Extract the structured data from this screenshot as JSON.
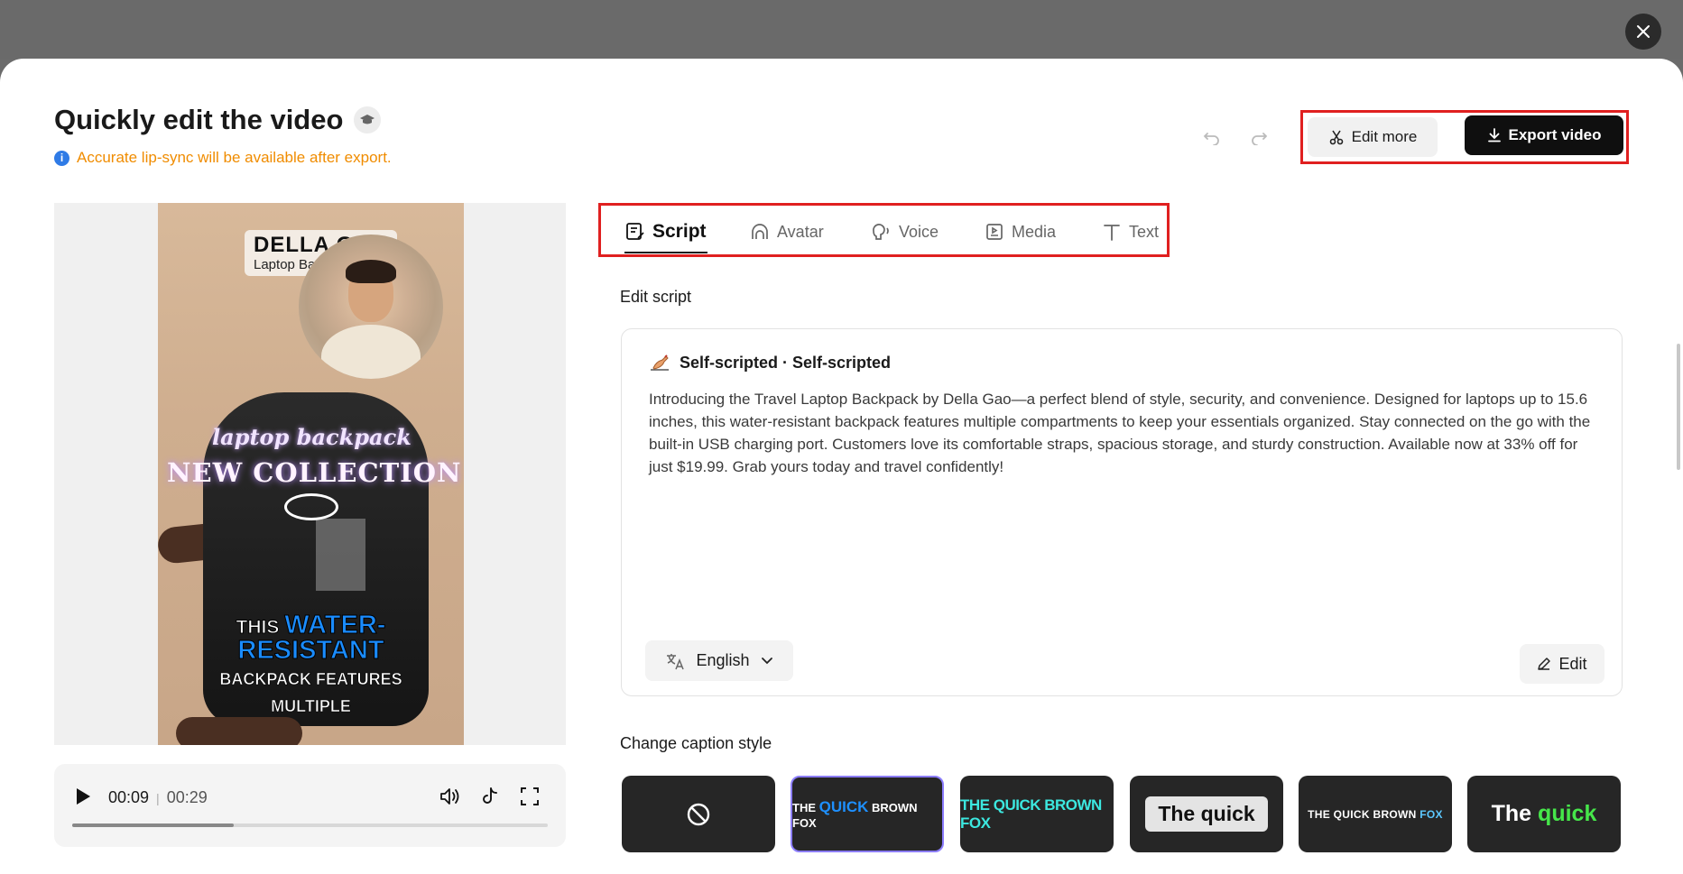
{
  "header": {
    "title": "Quickly edit the video",
    "notice": "Accurate lip-sync will be available after export.",
    "edit_more_label": "Edit more",
    "export_label": "Export video"
  },
  "video": {
    "brand_name": "DELLA GAO",
    "brand_sub": "Laptop Backpack",
    "overlay_script": "laptop backpack",
    "overlay_title": "NEW COLLECTION",
    "caption_line1_a": "THIS",
    "caption_line1_b": "WATER-",
    "caption_line2": "RESISTANT",
    "caption_line3": "BACKPACK FEATURES",
    "caption_line4": "MULTIPLE"
  },
  "player": {
    "current_time": "00:09",
    "duration": "00:29",
    "progress": 0.34
  },
  "tabs": [
    {
      "label": "Script",
      "active": true
    },
    {
      "label": "Avatar",
      "active": false
    },
    {
      "label": "Voice",
      "active": false
    },
    {
      "label": "Media",
      "active": false
    },
    {
      "label": "Text",
      "active": false
    }
  ],
  "script": {
    "section_label": "Edit script",
    "source": "Self-scripted · Self-scripted",
    "body": "Introducing the Travel Laptop Backpack by Della Gao—a perfect blend of style, security, and convenience. Designed for laptops up to 15.6 inches, this water-resistant backpack features multiple compartments to keep your essentials organized. Stay connected on the go with the built-in USB charging port. Customers love its comfortable straps, spacious storage, and sturdy construction. Available now at 33% off for just $19.99. Grab yours today and travel confidently!",
    "language": "English",
    "edit_label": "Edit"
  },
  "caption_styles": {
    "section_label": "Change caption style",
    "styles": [
      {
        "id": "none"
      },
      {
        "parts": [
          "THE ",
          "QUICK",
          " BROWN FOX"
        ],
        "selected": true
      },
      {
        "text": "THE QUICK BROWN FOX"
      },
      {
        "text": "The quick"
      },
      {
        "parts": [
          "THE QUICK BROWN ",
          "FOX"
        ]
      },
      {
        "parts": [
          "The ",
          "quick"
        ]
      }
    ]
  },
  "colors": {
    "accent_red_outline": "#e02020",
    "notice_orange": "#f08c00",
    "selected_style_border": "#8c7dff",
    "export_bg": "#0f0f0f"
  }
}
